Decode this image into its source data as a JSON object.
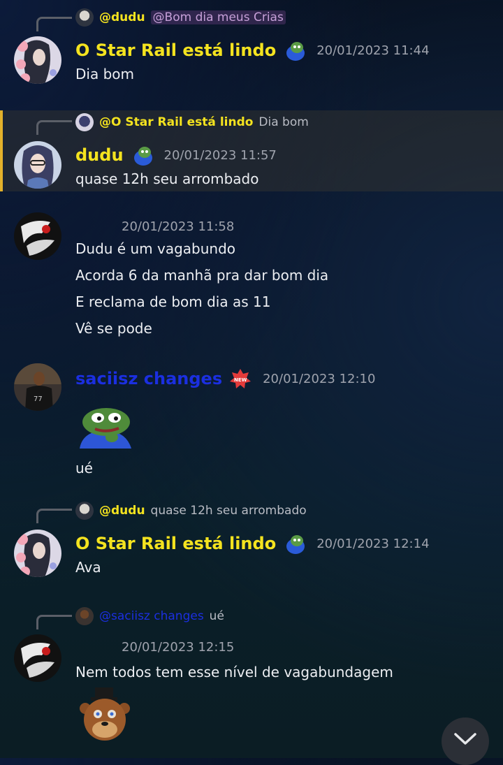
{
  "messages": [
    {
      "reply": {
        "name": "@dudu",
        "text": "@Bom dia meus Crias"
      },
      "username": "O Star Rail está lindo",
      "timestamp": "20/01/2023 11:44",
      "lines": [
        "Dia bom"
      ]
    },
    {
      "reply": {
        "name": "@O Star Rail está lindo",
        "text": "Dia bom"
      },
      "username": "dudu",
      "timestamp": "20/01/2023 11:57",
      "lines": [
        "quase 12h seu arrombado"
      ]
    },
    {
      "timestamp": "20/01/2023 11:58",
      "lines": [
        "Dudu é um vagabundo",
        "Acorda 6 da manhã pra dar bom dia",
        "E reclama de bom dia as 11",
        "Vê se pode"
      ]
    },
    {
      "username": "saciisz changes",
      "timestamp": "20/01/2023 12:10",
      "lines": [
        "ué"
      ]
    },
    {
      "reply": {
        "name": "@dudu",
        "text": "quase 12h seu arrombado"
      },
      "username": "O Star Rail está lindo",
      "timestamp": "20/01/2023 12:14",
      "lines": [
        "Ava"
      ]
    },
    {
      "reply": {
        "name": "@saciisz changes",
        "text": "ué"
      },
      "timestamp": "20/01/2023 12:15",
      "lines": [
        "Nem todos tem esse nível de vagabundagem"
      ]
    }
  ],
  "colors": {
    "highlight_bar": "#e3b12b",
    "yellow_name": "#f4e31f",
    "blue_name": "#1b2fe0"
  },
  "icons": [
    "pepe-badge-icon",
    "new-badge-icon",
    "pepe-sticker",
    "freddy-sticker",
    "chevron-down-icon"
  ]
}
